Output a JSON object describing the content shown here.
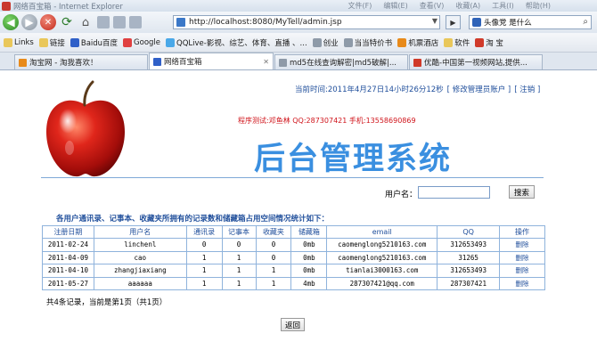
{
  "window": {
    "title": "网络百宝箱 - Internet Explorer",
    "menus": [
      "文件(F)",
      "编辑(E)",
      "查看(V)",
      "收藏(A)",
      "工具(I)",
      "帮助(H)"
    ]
  },
  "address": {
    "url": "http://localhost:8080/MyTell/admin.jsp"
  },
  "search_bar": {
    "text": "头像党 是什么"
  },
  "favorites": [
    {
      "label": "Links",
      "icon": "folder-icon"
    },
    {
      "label": "链接",
      "icon": "folder-icon"
    },
    {
      "label": "Baidu百度",
      "icon": "baidu-icon"
    },
    {
      "label": "Google",
      "icon": "google-icon"
    },
    {
      "label": "QQLive-影视、综艺、体育、直播 、...",
      "icon": "qq-icon"
    },
    {
      "label": "创业",
      "icon": "page-icon"
    },
    {
      "label": "当当特价书",
      "icon": "page-icon"
    },
    {
      "label": "机票酒店",
      "icon": "page-icon"
    },
    {
      "label": "软件",
      "icon": "folder-icon"
    },
    {
      "label": "淘 宝",
      "icon": "taobao-icon"
    }
  ],
  "tabs": [
    {
      "label": "淘宝网 - 淘我喜欢！",
      "active": false
    },
    {
      "label": "网络百宝箱",
      "active": true
    },
    {
      "label": "md5在线查询解密|md5破解|...",
      "active": false
    },
    {
      "label": "优酷-中国第一视频网站,提供...",
      "active": false
    }
  ],
  "header": {
    "datetime": "当前时间:2011年4月27日14小时26分12秒",
    "modify_admin_link": "[ 修改管理员账户 ]",
    "logout_link": "[ 注销 ]",
    "programmer": "程序测试:邓鱼林 QQ:287307421 手机:13558690869",
    "title": "后台管理系统"
  },
  "search": {
    "label": "用户名：",
    "value": "",
    "button": "搜索"
  },
  "table": {
    "caption": "各用户通讯录、记事本、收藏夹所拥有的记录数和储藏箱占用空间情况统计如下：",
    "headers": [
      "注册日期",
      "用户名",
      "通讯录",
      "记事本",
      "收藏夹",
      "储藏箱",
      "email",
      "QQ",
      "操作"
    ],
    "rows": [
      [
        "2011-02-24",
        "linchenl",
        "0",
        "0",
        "0",
        "0mb",
        "caomenglong5210163.com",
        "312653493",
        "删除"
      ],
      [
        "2011-04-09",
        "cao",
        "1",
        "1",
        "0",
        "0mb",
        "caomenglong5210163.com",
        "31265",
        "删除"
      ],
      [
        "2011-04-10",
        "zhangjiaxiang",
        "1",
        "1",
        "1",
        "0mb",
        "tianlai3000163.com",
        "312653493",
        "删除"
      ],
      [
        "2011-05-27",
        "aaaaaa",
        "1",
        "1",
        "1",
        "4mb",
        "287307421@qq.com",
        "287307421",
        "删除"
      ]
    ]
  },
  "pager": {
    "text": "共4条记录，当前是第1页（共1页）"
  },
  "back_button": "返回"
}
